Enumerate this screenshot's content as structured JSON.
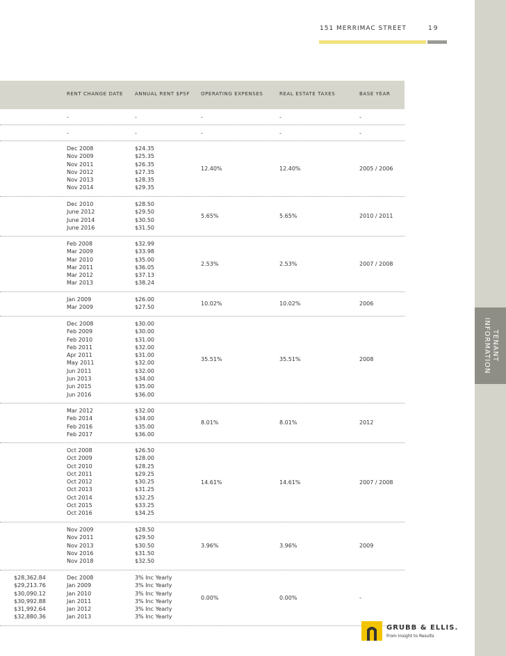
{
  "header": {
    "title": "151 MERRIMAC STREET",
    "page_number": "19"
  },
  "side_tab": {
    "line1": "TENANT",
    "line2": "INFORMATION"
  },
  "table": {
    "columns": [
      "RENT CHANGE DATE",
      "ANNUAL RENT $PSF",
      "OPERATING EXPENSES",
      "REAL ESTATE TAXES",
      "BASE YEAR"
    ],
    "rows": [
      {
        "pre": [],
        "dates": [
          "-"
        ],
        "rents": [
          "-"
        ],
        "opex": "-",
        "taxes": "-",
        "base_year": "-"
      },
      {
        "pre": [],
        "dates": [
          "-"
        ],
        "rents": [
          "-"
        ],
        "opex": "-",
        "taxes": "-",
        "base_year": "-"
      },
      {
        "pre": [],
        "dates": [
          "Dec 2008",
          "Nov 2009",
          "Nov 2011",
          "Nov 2012",
          "Nov 2013",
          "Nov 2014"
        ],
        "rents": [
          "$24.35",
          "$25.35",
          "$26.35",
          "$27.35",
          "$28.35",
          "$29.35"
        ],
        "opex": "12.40%",
        "taxes": "12.40%",
        "base_year": "2005 / 2006"
      },
      {
        "pre": [],
        "dates": [
          "Dec 2010",
          "June 2012",
          "June 2014",
          "June 2016"
        ],
        "rents": [
          "$28.50",
          "$29.50",
          "$30.50",
          "$31.50"
        ],
        "opex": "5.65%",
        "taxes": "5.65%",
        "base_year": "2010 / 2011"
      },
      {
        "pre": [],
        "dates": [
          "Feb 2008",
          "Mar 2009",
          "Mar 2010",
          "Mar 2011",
          "Mar 2012",
          "Mar 2013"
        ],
        "rents": [
          "$32.99",
          "$33.98",
          "$35.00",
          "$36.05",
          "$37.13",
          "$38.24"
        ],
        "opex": "2.53%",
        "taxes": "2.53%",
        "base_year": "2007 / 2008"
      },
      {
        "pre": [],
        "dates": [
          "Jan 2009",
          "Mar 2009"
        ],
        "rents": [
          "$26.00",
          "$27.50"
        ],
        "opex": "10.02%",
        "taxes": "10.02%",
        "base_year": "2006"
      },
      {
        "pre": [],
        "dates": [
          "Dec 2008",
          "Feb 2009",
          "Feb 2010",
          "Feb 2011",
          "Apr 2011",
          "May 2011",
          "Jun 2011",
          "Jun 2013",
          "Jun 2015",
          "Jun 2016"
        ],
        "rents": [
          "$30.00",
          "$30.00",
          "$31.00",
          "$32.00",
          "$31.00",
          "$32.00",
          "$32.00",
          "$34.00",
          "$35.00",
          "$36.00"
        ],
        "opex": "35.51%",
        "taxes": "35.51%",
        "base_year": "2008"
      },
      {
        "pre": [],
        "dates": [
          "Mar 2012",
          "Feb 2014",
          "Feb 2016",
          "Feb 2017"
        ],
        "rents": [
          "$32.00",
          "$34.00",
          "$35.00",
          "$36.00"
        ],
        "opex": "8.01%",
        "taxes": "8.01%",
        "base_year": "2012"
      },
      {
        "pre": [],
        "dates": [
          "Oct 2008",
          "Oct 2009",
          "Oct 2010",
          "Oct 2011",
          "Oct 2012",
          "Oct 2013",
          "Oct 2014",
          "Oct 2015",
          "Oct 2016"
        ],
        "rents": [
          "$26.50",
          "$28.00",
          "$28.25",
          "$29.25",
          "$30.25",
          "$31.25",
          "$32.25",
          "$33.25",
          "$34.25"
        ],
        "opex": "14.61%",
        "taxes": "14.61%",
        "base_year": "2007 / 2008"
      },
      {
        "pre": [],
        "dates": [
          "Nov 2009",
          "Nov 2011",
          "Nov 2013",
          "Nov 2016",
          "Nov 2018"
        ],
        "rents": [
          "$28.50",
          "$29.50",
          "$30.50",
          "$31.50",
          "$32.50"
        ],
        "opex": "3.96%",
        "taxes": "3.96%",
        "base_year": "2009"
      },
      {
        "pre": [
          "$28,362.84",
          "$29,213.76",
          "$30,090.12",
          "$30,992.88",
          "$31,992.64",
          "$32,880.36"
        ],
        "dates": [
          "Dec 2008",
          "Jan 2009",
          "Jan 2010",
          "Jan 2011",
          "Jan 2012",
          "Jan 2013"
        ],
        "rents": [
          "3% Inc Yearly",
          "3% Inc Yearly",
          "3% Inc Yearly",
          "3% Inc Yearly",
          "3% Inc Yearly",
          "3% Inc Yearly"
        ],
        "opex": "0.00%",
        "taxes": "0.00%",
        "base_year": "-"
      }
    ]
  },
  "logo": {
    "name": "GRUBB & ELLIS.",
    "tagline": "From Insight to Results"
  },
  "colors": {
    "header_band": "#d6d6cc",
    "accent_yellow": "#f2e27a",
    "accent_gray": "#9a9a94",
    "tab_bg": "#8e8e86",
    "logo_yellow": "#f2c400"
  }
}
